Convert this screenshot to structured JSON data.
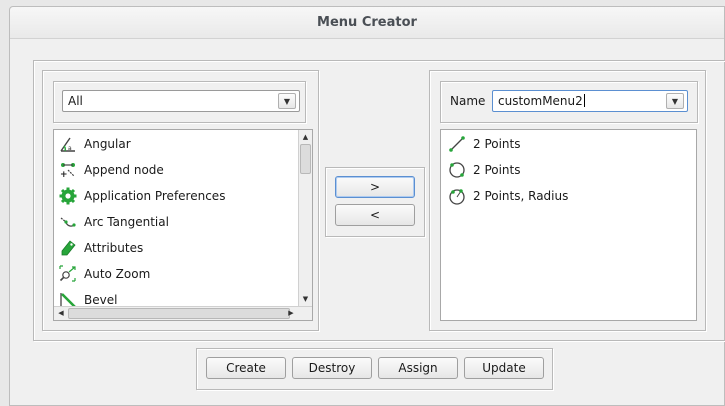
{
  "window": {
    "title": "Menu Creator"
  },
  "left_panel": {
    "filter": {
      "selected": "All"
    },
    "items": [
      {
        "label": "Angular",
        "icon": "angular-dimension-icon"
      },
      {
        "label": "Append node",
        "icon": "append-node-icon"
      },
      {
        "label": "Application Preferences",
        "icon": "gear-icon"
      },
      {
        "label": "Arc Tangential",
        "icon": "arc-tangential-icon"
      },
      {
        "label": "Attributes",
        "icon": "attributes-tag-icon"
      },
      {
        "label": "Auto Zoom",
        "icon": "auto-zoom-icon"
      },
      {
        "label": "Bevel",
        "icon": "bevel-icon"
      }
    ]
  },
  "transfer": {
    "add_label": ">",
    "remove_label": "<"
  },
  "right_panel": {
    "name_label": "Name",
    "name_value": "customMenu2",
    "items": [
      {
        "label": "2 Points",
        "icon": "line-2-points-icon"
      },
      {
        "label": "2 Points",
        "icon": "circle-2-points-icon"
      },
      {
        "label": "2 Points, Radius",
        "icon": "circle-2-points-radius-icon"
      }
    ]
  },
  "actions": {
    "create": "Create",
    "destroy": "Destroy",
    "assign": "Assign",
    "update": "Update"
  },
  "colors": {
    "accent": "#5b8fd1",
    "icon_green": "#27a53a",
    "window_bg": "#f0f0f0"
  }
}
